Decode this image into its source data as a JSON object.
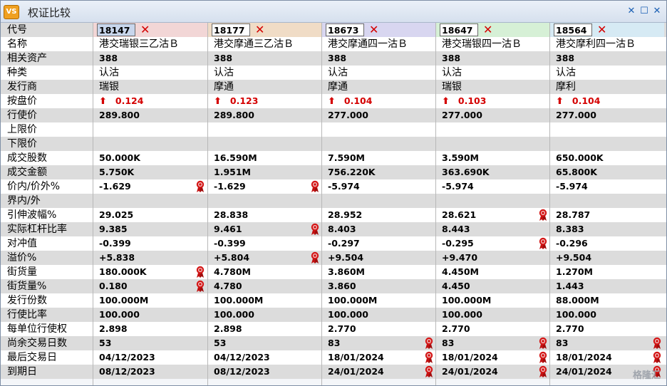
{
  "window": {
    "title": "权证比较",
    "app_icon": "VS"
  },
  "row_labels": [
    "代号",
    "名称",
    "相关资产",
    "种类",
    "发行商",
    "按盘价",
    "行使价",
    "上限价",
    "下限价",
    "成交股数",
    "成交金额",
    "价内/价外%",
    "界内/外",
    "引伸波幅%",
    "实际杠杆比率",
    "对冲值",
    "溢价%",
    "街货量",
    "街货量%",
    "发行份数",
    "行使比率",
    "每单位行使权",
    "尚余交易日数",
    "最后交易日",
    "到期日"
  ],
  "columns": [
    {
      "code": "18147",
      "header_color": "#f2d6d6",
      "name": "港交瑞银三乙沽Ｂ",
      "underlying": "388",
      "type": "认沽",
      "issuer": "瑞银",
      "price": "0.124",
      "strike": "289.800",
      "upper": "",
      "lower": "",
      "volume": "50.000K",
      "turnover": "5.750K",
      "moneyness": "-1.629",
      "inout": "",
      "iv": "29.025",
      "leverage": "9.385",
      "delta": "-0.399",
      "premium": "+5.838",
      "outstanding": "180.000K",
      "outstanding_pct": "0.180",
      "issue_size": "100.000M",
      "ratio": "100.000",
      "per_unit": "2.898",
      "days_left": "53",
      "last_trade": "04/12/2023",
      "expiry": "08/12/2023"
    },
    {
      "code": "18177",
      "header_color": "#f0dcc6",
      "name": "港交摩通三乙沽Ｂ",
      "underlying": "388",
      "type": "认沽",
      "issuer": "摩通",
      "price": "0.123",
      "strike": "289.800",
      "upper": "",
      "lower": "",
      "volume": "16.590M",
      "turnover": "1.951M",
      "moneyness": "-1.629",
      "inout": "",
      "iv": "28.838",
      "leverage": "9.461",
      "delta": "-0.399",
      "premium": "+5.804",
      "outstanding": "4.780M",
      "outstanding_pct": "4.780",
      "issue_size": "100.000M",
      "ratio": "100.000",
      "per_unit": "2.898",
      "days_left": "53",
      "last_trade": "04/12/2023",
      "expiry": "08/12/2023"
    },
    {
      "code": "18673",
      "header_color": "#d8d6f0",
      "name": "港交摩通四一沽Ｂ",
      "underlying": "388",
      "type": "认沽",
      "issuer": "摩通",
      "price": "0.104",
      "strike": "277.000",
      "upper": "",
      "lower": "",
      "volume": "7.590M",
      "turnover": "756.220K",
      "moneyness": "-5.974",
      "inout": "",
      "iv": "28.952",
      "leverage": "8.403",
      "delta": "-0.297",
      "premium": "+9.504",
      "outstanding": "3.860M",
      "outstanding_pct": "3.860",
      "issue_size": "100.000M",
      "ratio": "100.000",
      "per_unit": "2.770",
      "days_left": "83",
      "last_trade": "18/01/2024",
      "expiry": "24/01/2024"
    },
    {
      "code": "18647",
      "header_color": "#d6f0d6",
      "name": "港交瑞银四一沽Ｂ",
      "underlying": "388",
      "type": "认沽",
      "issuer": "瑞银",
      "price": "0.103",
      "strike": "277.000",
      "upper": "",
      "lower": "",
      "volume": "3.590M",
      "turnover": "363.690K",
      "moneyness": "-5.974",
      "inout": "",
      "iv": "28.621",
      "leverage": "8.443",
      "delta": "-0.295",
      "premium": "+9.470",
      "outstanding": "4.450M",
      "outstanding_pct": "4.450",
      "issue_size": "100.000M",
      "ratio": "100.000",
      "per_unit": "2.770",
      "days_left": "83",
      "last_trade": "18/01/2024",
      "expiry": "24/01/2024"
    },
    {
      "code": "18564",
      "header_color": "#d6eaf4",
      "name": "港交摩利四一沽Ｂ",
      "underlying": "388",
      "type": "认沽",
      "issuer": "摩利",
      "price": "0.104",
      "strike": "277.000",
      "upper": "",
      "lower": "",
      "volume": "650.000K",
      "turnover": "65.800K",
      "moneyness": "-5.974",
      "inout": "",
      "iv": "28.787",
      "leverage": "8.383",
      "delta": "-0.296",
      "premium": "+9.504",
      "outstanding": "1.270M",
      "outstanding_pct": "1.443",
      "issue_size": "88.000M",
      "ratio": "100.000",
      "per_unit": "2.770",
      "days_left": "83",
      "last_trade": "18/01/2024",
      "expiry": "24/01/2024"
    }
  ],
  "ribbons": {
    "moneyness": [
      0,
      1
    ],
    "iv": [
      3
    ],
    "leverage": [
      1
    ],
    "delta": [
      3
    ],
    "premium": [
      1
    ],
    "outstanding": [
      0
    ],
    "outstanding_pct": [
      0
    ],
    "days_left": [
      2,
      3,
      4
    ],
    "last_trade": [
      2,
      3,
      4
    ],
    "expiry": [
      2,
      3,
      4
    ]
  },
  "watermark": "格隆汇",
  "colors": {
    "accent_red": "#d40000",
    "row_alt": "#dcdcdc",
    "selected_code": "#c8d6ec"
  }
}
